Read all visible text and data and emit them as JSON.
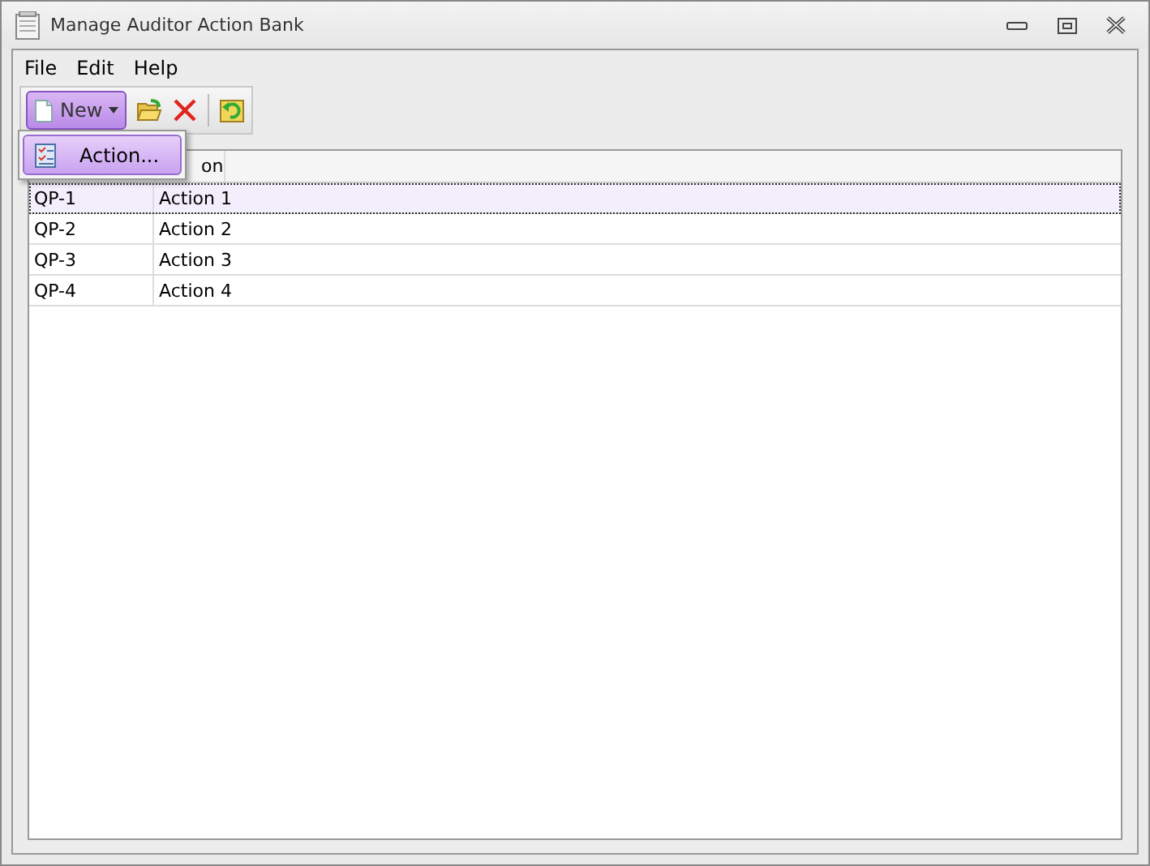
{
  "window": {
    "title": "Manage Auditor Action Bank"
  },
  "menu": [
    "File",
    "Edit",
    "Help"
  ],
  "toolbar": {
    "new_button": {
      "label": "New",
      "expanded": true
    },
    "dropdown": [
      {
        "label": "Action...",
        "selected": true
      }
    ]
  },
  "table": {
    "column_2_visible": "on",
    "rows": [
      {
        "id": "QP-1",
        "action": "Action 1",
        "selected": true
      },
      {
        "id": "QP-2",
        "action": "Action 2",
        "selected": false
      },
      {
        "id": "QP-3",
        "action": "Action 3",
        "selected": false
      },
      {
        "id": "QP-4",
        "action": "Action 4",
        "selected": false
      }
    ]
  }
}
